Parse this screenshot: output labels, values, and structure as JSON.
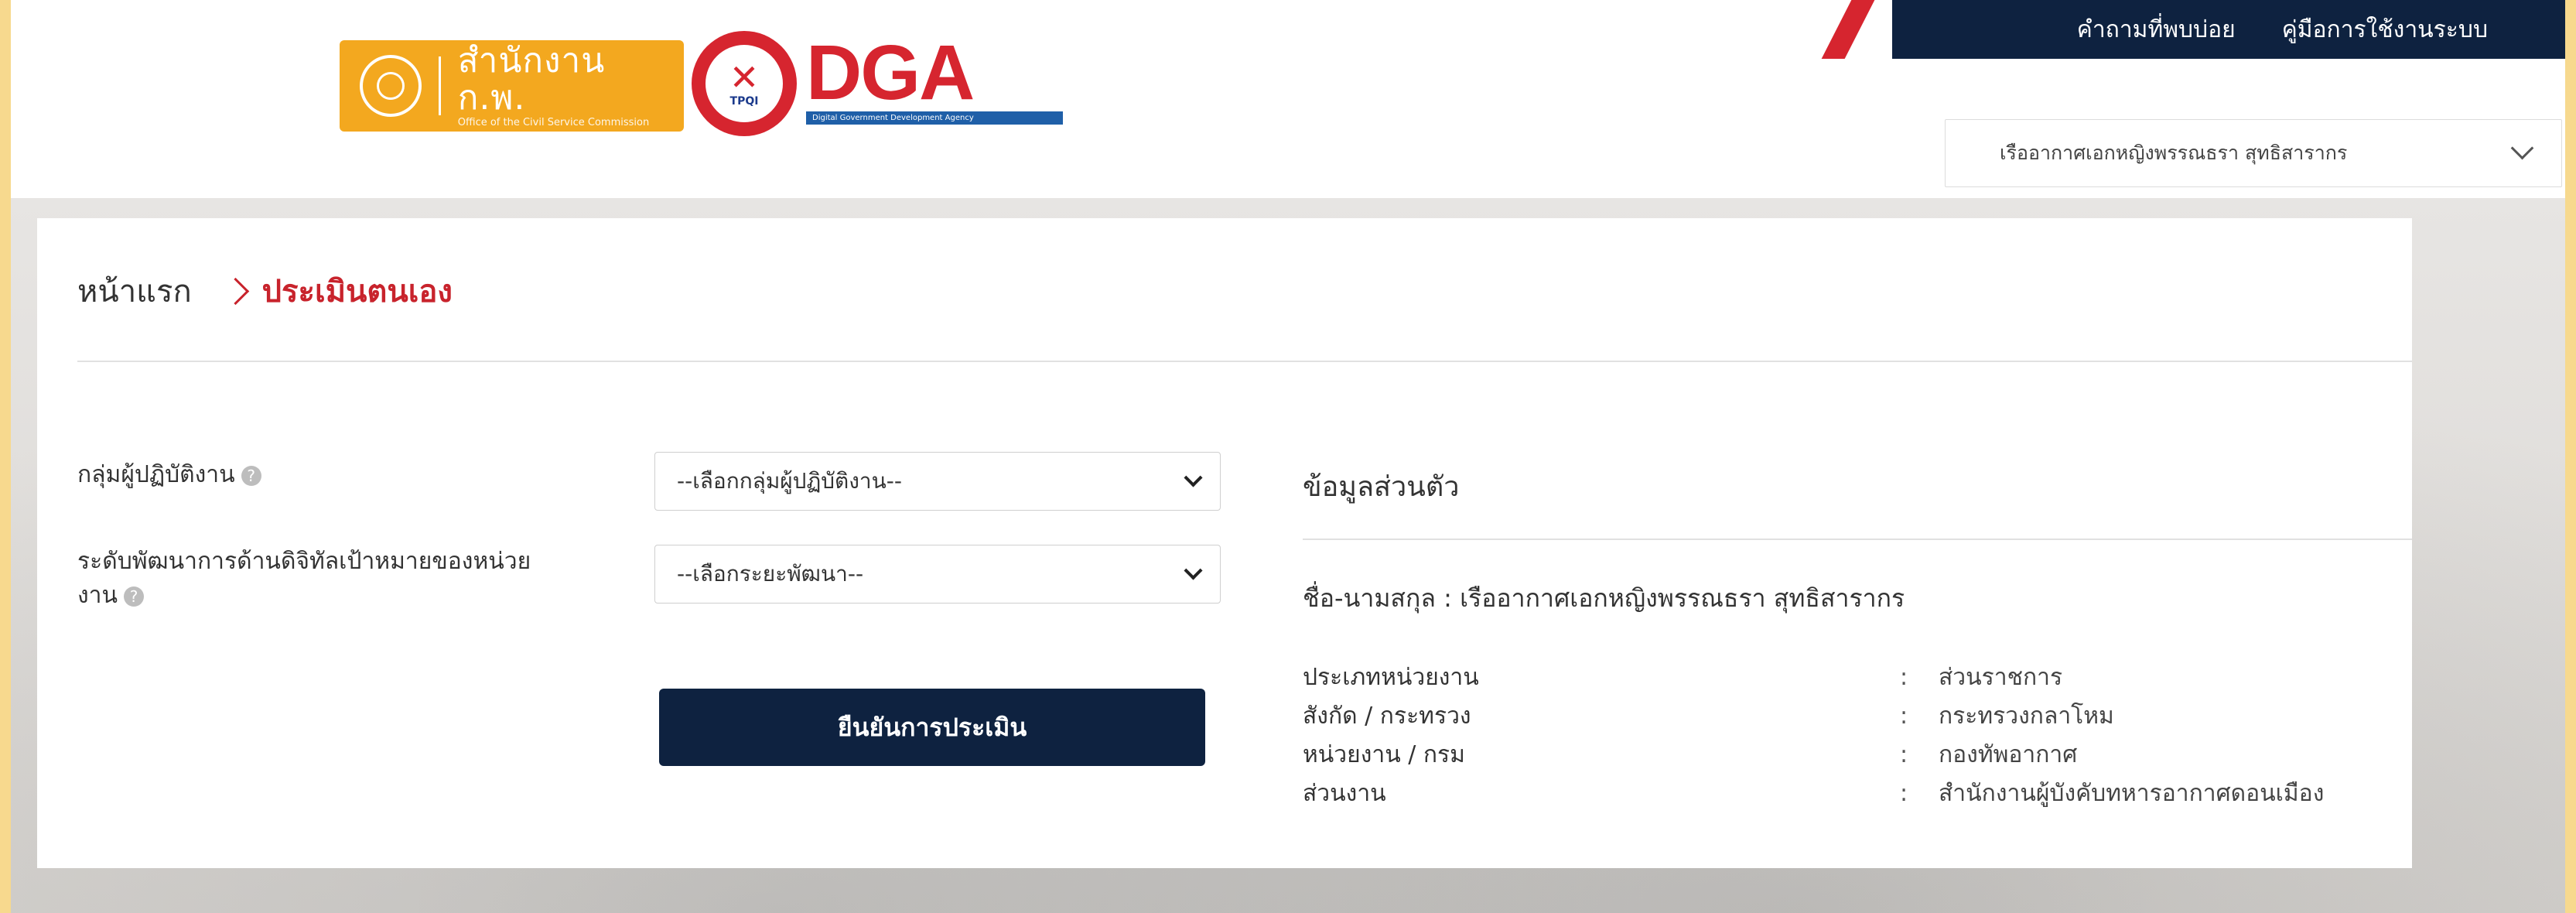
{
  "header": {
    "ocsc_logo": {
      "th": "สำนักงาน ก.พ.",
      "en": "Office of the Civil Service Commission"
    },
    "tpqi_logo": {
      "text": "TPQI"
    },
    "dga_logo": {
      "word": "DGA",
      "sub": "Digital Government Development Agency"
    },
    "topbar": {
      "faq_label": "คำถามที่พบบ่อย",
      "manual_label": "คู่มือการใช้งานระบบ"
    },
    "user_select": {
      "value": "เรืออากาศเอกหญิงพรรณธรา สุทธิสารากร"
    }
  },
  "breadcrumb": {
    "home": "หน้าแรก",
    "current": "ประเมินตนเอง"
  },
  "form": {
    "group_label": "กลุ่มผู้ปฏิบัติงาน",
    "group_select": "--เลือกกลุ่มผู้ปฏิบัติงาน--",
    "level_label_line1": "ระดับพัฒนาการด้านดิจิทัลเป้าหมายของหน่วย",
    "level_label_line2": "งาน",
    "level_select": "--เลือกระยะพัฒนา--",
    "help_icon": "?",
    "confirm_button": "ยืนยันการประเมิน"
  },
  "profile": {
    "title": "ข้อมูลส่วนตัว",
    "fullname": "ชื่อ-นามสกุล : เรืออากาศเอกหญิงพรรณธรา สุทธิสารากร",
    "rows": [
      {
        "label": "ประเภทหน่วยงาน",
        "value": "ส่วนราชการ"
      },
      {
        "label": "สังกัด / กระทรวง",
        "value": "กระทรวงกลาโหม"
      },
      {
        "label": "หน่วยงาน / กรม",
        "value": "กองทัพอากาศ"
      },
      {
        "label": "ส่วนงาน",
        "value": "สำนักงานผู้บังคับทหารอากาศดอนเมือง"
      }
    ],
    "colon": ":"
  },
  "colors": {
    "navy": "#0e2240",
    "red": "#c8232c",
    "orange": "#f3a81f",
    "frame": "#f7d98e"
  }
}
